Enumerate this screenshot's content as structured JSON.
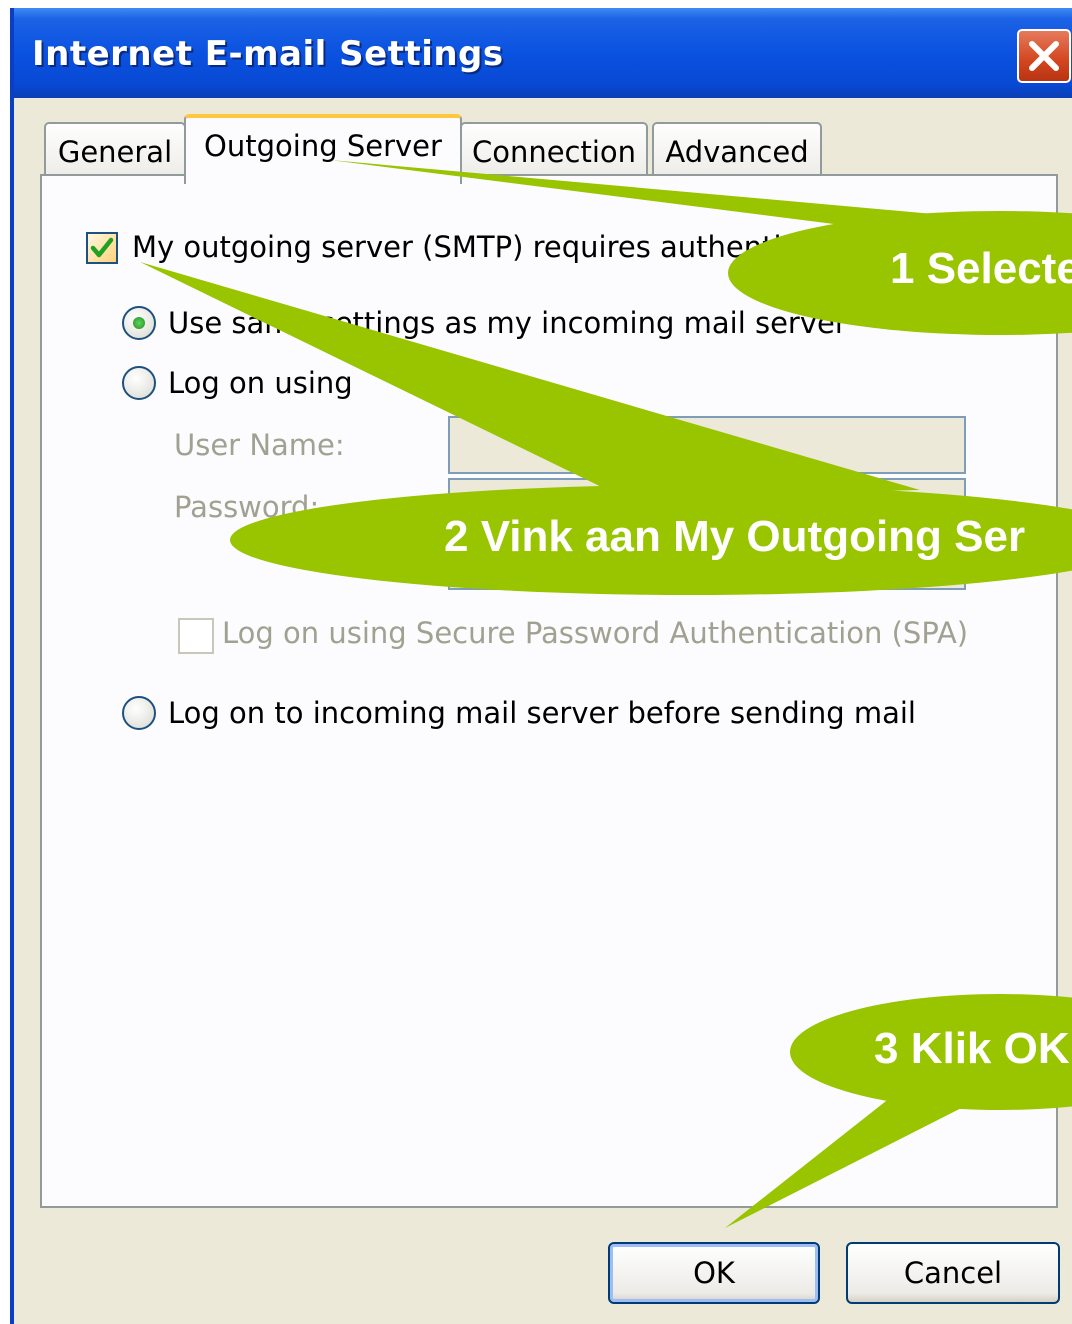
{
  "window": {
    "title": "Internet E-mail Settings"
  },
  "tabs": [
    {
      "label": "General",
      "active": false
    },
    {
      "label": "Outgoing Server",
      "active": true
    },
    {
      "label": "Connection",
      "active": false
    },
    {
      "label": "Advanced",
      "active": false
    }
  ],
  "outgoing": {
    "auth_checkbox_label": "My outgoing server (SMTP) requires authentication",
    "auth_checked": true,
    "radio_same_settings": "Use same settings as my incoming mail server",
    "radio_log_on_using": "Log on using",
    "user_name_label": "User Name:",
    "password_label": "Password:",
    "spa_label": "Log on using Secure Password Authentication (SPA)",
    "radio_log_on_incoming": "Log on to incoming mail server before sending mail",
    "selected_option": "Use same settings as my incoming mail server"
  },
  "buttons": {
    "ok": "OK",
    "cancel": "Cancel"
  },
  "callouts": [
    {
      "text": "1 Selecte"
    },
    {
      "text": "2 Vink aan My Outgoing Ser"
    },
    {
      "text": "3 Klik OK"
    }
  ],
  "colors": {
    "callout_green": "#99c400",
    "titlebar_blue": "#0a52e0",
    "active_tab_accent": "#ffc83c"
  }
}
